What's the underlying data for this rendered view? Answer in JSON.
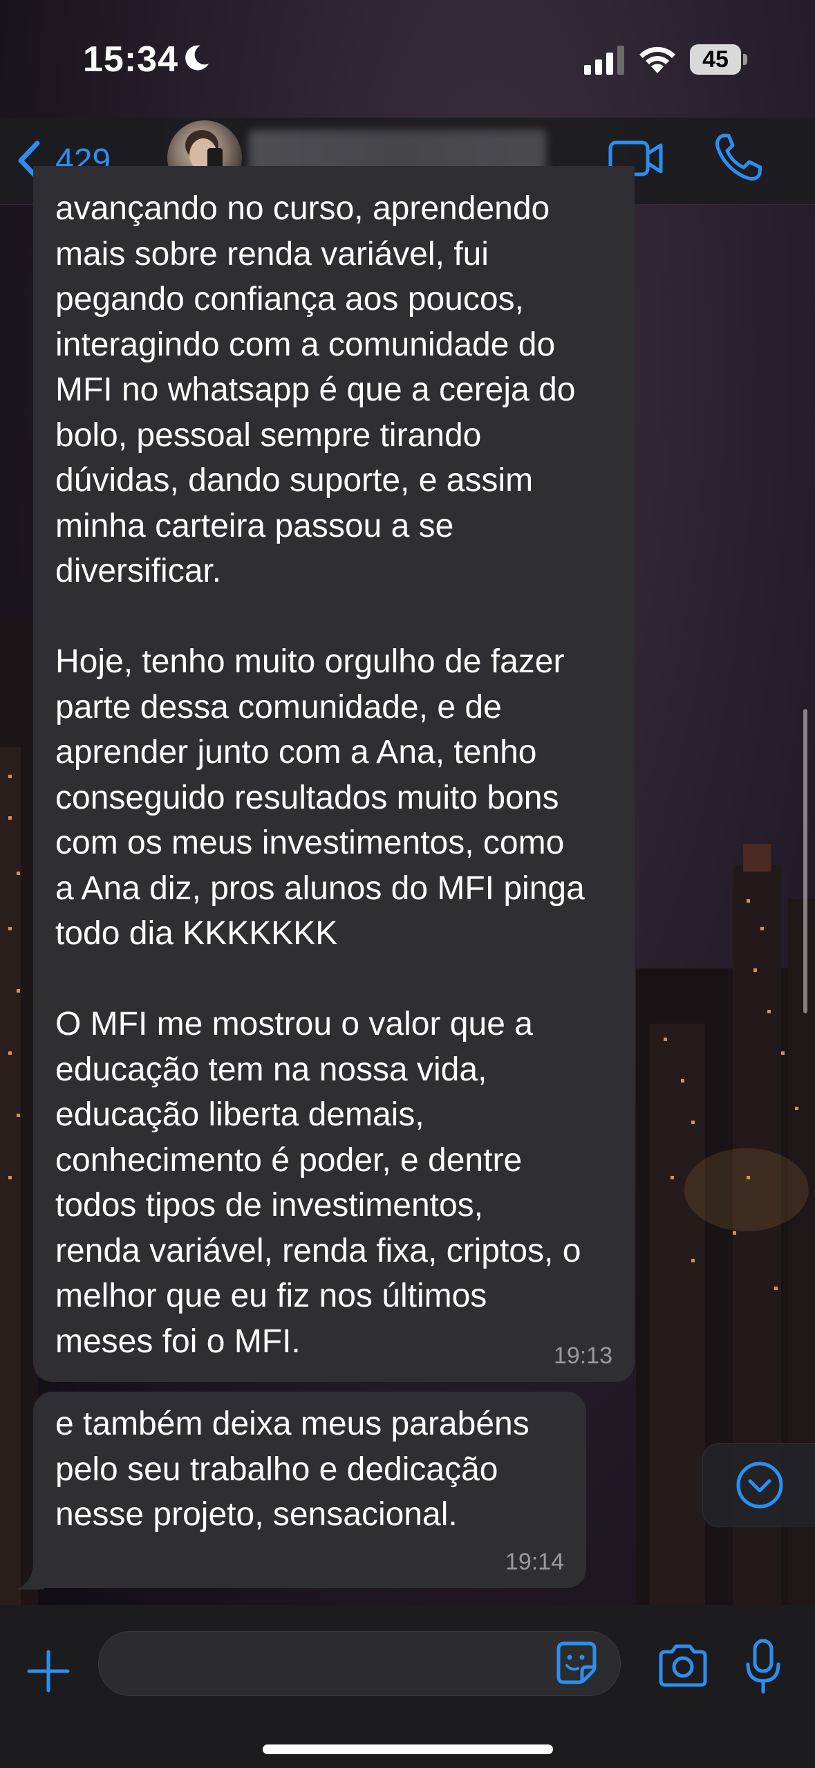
{
  "status_bar": {
    "time": "15:34",
    "battery": "45"
  },
  "header": {
    "back_count": "429"
  },
  "messages": [
    {
      "text": "avançando no curso, aprendendo\nmais sobre renda variável, fui\npegando confiança aos poucos,\ninteragindo com a comunidade do\nMFI no whatsapp é que a cereja do\nbolo, pessoal sempre tirando\ndúvidas, dando suporte, e assim\nminha carteira passou a se\ndiversificar.\n\nHoje, tenho muito orgulho de fazer\nparte dessa comunidade, e de\naprender junto com a Ana, tenho\nconseguido resultados muito bons\ncom os meus investimentos, como\na Ana diz, pros alunos do MFI pinga\ntodo dia KKKKKKK\n\nO MFI me mostrou o valor que a\neducação tem na nossa vida,\neducação liberta demais,\nconhecimento é poder, e dentre\ntodos tipos de investimentos,\nrenda variável, renda fixa, criptos, o\nmelhor que eu fiz nos últimos\nmeses foi o MFI.",
      "time": "19:13"
    },
    {
      "text": "e também deixa meus parabéns\npelo seu trabalho e dedicação\nnesse projeto, sensacional.",
      "time": "19:14"
    }
  ],
  "colors": {
    "accent": "#2c8ff0",
    "bubble": "#2f2f33",
    "timestamp": "#9a9a9e"
  },
  "icons": {
    "moon": "moon-icon",
    "signal": "cellular-signal-icon",
    "wifi": "wifi-icon",
    "back": "chevron-left-icon",
    "video": "video-camera-icon",
    "call": "phone-icon",
    "scroll_down": "chevron-down-circle-icon",
    "plus": "plus-icon",
    "sticker": "sticker-icon",
    "camera": "camera-icon",
    "mic": "microphone-icon"
  }
}
